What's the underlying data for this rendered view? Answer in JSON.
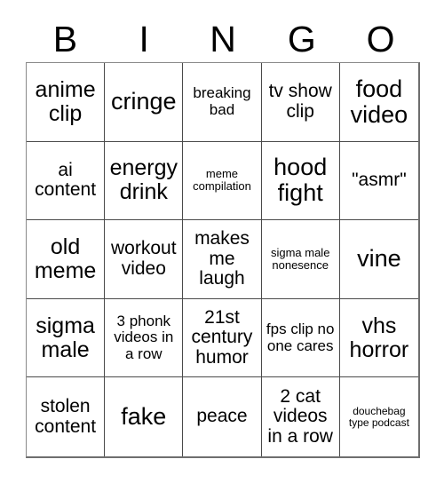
{
  "card": {
    "type": "bingo-card",
    "header_letters": [
      "B",
      "I",
      "N",
      "G",
      "O"
    ],
    "columns": 5,
    "rows": 5,
    "colors": {
      "background": "#ffffff",
      "text": "#000000",
      "grid_line": "#4a4a4a",
      "outer_border": "#6e6e6e"
    },
    "cells": [
      {
        "text": "anime clip",
        "size": "fs-lg"
      },
      {
        "text": "cringe",
        "size": "fs-xl"
      },
      {
        "text": "breaking bad",
        "size": "fs-sm"
      },
      {
        "text": "tv show clip",
        "size": "fs-md"
      },
      {
        "text": "food video",
        "size": "fs-xl"
      },
      {
        "text": "ai content",
        "size": "fs-md"
      },
      {
        "text": "energy drink",
        "size": "fs-lg"
      },
      {
        "text": "meme compilation",
        "size": "fs-xs"
      },
      {
        "text": "hood fight",
        "size": "fs-xl"
      },
      {
        "text": "\"asmr\"",
        "size": "fs-md"
      },
      {
        "text": "old meme",
        "size": "fs-lg"
      },
      {
        "text": "workout video",
        "size": "fs-md"
      },
      {
        "text": "makes me laugh",
        "size": "fs-md"
      },
      {
        "text": "sigma male nonesence",
        "size": "fs-xs"
      },
      {
        "text": "vine",
        "size": "fs-xl"
      },
      {
        "text": "sigma male",
        "size": "fs-lg"
      },
      {
        "text": "3 phonk videos in a row",
        "size": "fs-sm"
      },
      {
        "text": "21st century humor",
        "size": "fs-md"
      },
      {
        "text": "fps clip no one cares",
        "size": "fs-sm"
      },
      {
        "text": "vhs horror",
        "size": "fs-lg"
      },
      {
        "text": "stolen content",
        "size": "fs-md"
      },
      {
        "text": "fake",
        "size": "fs-xl"
      },
      {
        "text": "peace",
        "size": "fs-md"
      },
      {
        "text": "2 cat videos in a row",
        "size": "fs-md"
      },
      {
        "text": "douchebag type podcast",
        "size": "fs-xxs"
      }
    ]
  }
}
